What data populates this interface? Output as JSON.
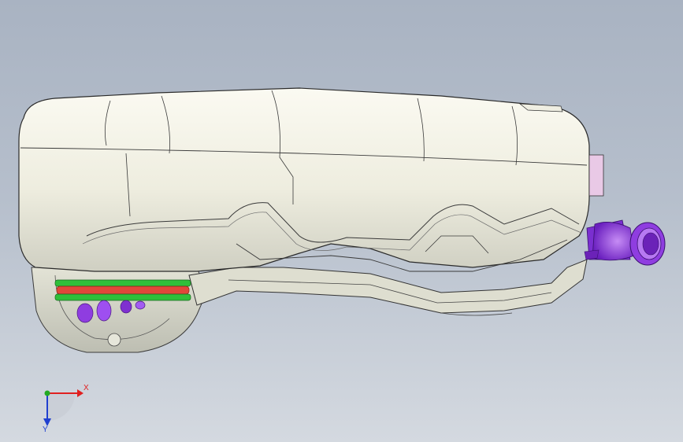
{
  "viewport": {
    "background_top": "#a9b3c2",
    "background_bottom": "#d4d9e0"
  },
  "model": {
    "body_color": "#f3f2e6",
    "edge_color": "#2a2a2a",
    "shadow_color": "#9aa2a8",
    "filler_neck_color": "#8a2be2",
    "pump_flange_red": "#e0473a",
    "pump_flange_green": "#2fbf3a",
    "pump_valve_color": "#8f3de0",
    "side_tab_color": "#e9c9e6"
  },
  "triad": {
    "x_label": "X",
    "y_label": "Y",
    "x_color": "#e02020",
    "y_color": "#22aa22",
    "z_color": "#2040d0"
  }
}
